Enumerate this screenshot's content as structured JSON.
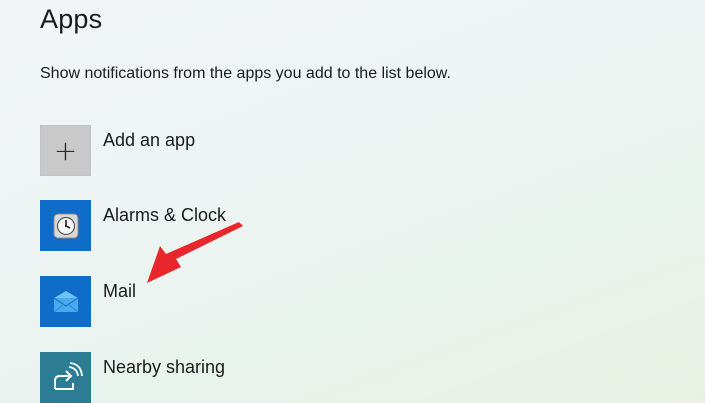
{
  "section": {
    "title": "Apps",
    "description": "Show notifications from the apps you add to the list below."
  },
  "apps": [
    {
      "label": "Add an app",
      "icon": "plus-icon"
    },
    {
      "label": "Alarms & Clock",
      "icon": "clock-icon"
    },
    {
      "label": "Mail",
      "icon": "mail-icon"
    },
    {
      "label": "Nearby sharing",
      "icon": "nearby-sharing-icon"
    }
  ],
  "colors": {
    "add_tile": "#c9c9c9",
    "app_tile_blue": "#0f6cc8",
    "app_tile_teal": "#2c7c93",
    "annotation_arrow": "#e8262b"
  }
}
